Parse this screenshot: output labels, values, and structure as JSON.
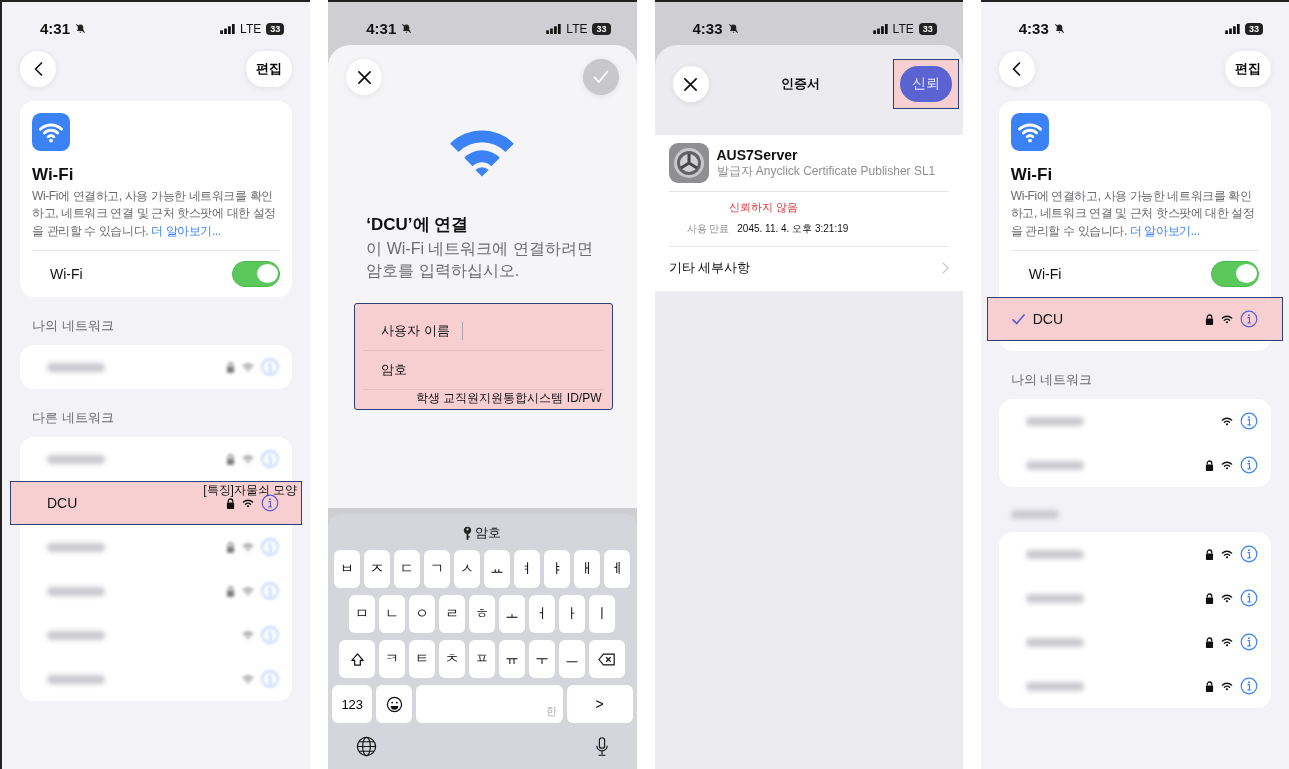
{
  "panels": [
    {
      "kind": "network_list",
      "status_bar": {
        "time": "4:31",
        "network": "LTE",
        "battery": "33"
      },
      "edit_button": "편집",
      "wifi_card": {
        "title": "Wi-Fi",
        "description": "Wi-Fi에 연결하고, 사용 가능한 네트워크를 확인하고, 네트워크 연결 및 근처 핫스팟에 대한 설정을 관리할 수 있습니다.",
        "link": "더 알아보기...",
        "toggle_label": "Wi-Fi",
        "on": true
      },
      "sections": [
        {
          "header": "나의 네트워크",
          "rows": [
            {
              "locked": true,
              "faded": true,
              "highlighted": false,
              "checked": false
            }
          ]
        },
        {
          "header": "다른 네트워크",
          "rows": [
            {
              "locked": true,
              "faded": true,
              "highlighted": false,
              "checked": false
            },
            {
              "name": "DCU",
              "note": "[특징]자물쇠 모양",
              "locked": true,
              "faded": false,
              "highlighted": true,
              "checked": false
            },
            {
              "locked": true,
              "faded": true,
              "highlighted": false,
              "checked": false
            },
            {
              "locked": true,
              "faded": true,
              "highlighted": false,
              "checked": false
            },
            {
              "locked": false,
              "faded": true,
              "highlighted": false,
              "checked": false
            },
            {
              "locked": false,
              "faded": true,
              "highlighted": false,
              "checked": false
            }
          ]
        }
      ]
    },
    {
      "kind": "join_form",
      "status_bar": {
        "time": "4:31",
        "network": "LTE",
        "battery": "33"
      },
      "confirm_disabled": true,
      "title": "‘DCU’에 연결",
      "subtitle": "이 Wi-Fi 네트워크에 연결하려면 암호를 입력하십시오.",
      "form": {
        "highlighted": true,
        "note": "학생 교직원지원통합시스템 ID/PW",
        "fields": [
          {
            "label": "사용자 이름",
            "focused": true
          },
          {
            "label": "암호",
            "focused": false
          }
        ]
      },
      "keyboard": {
        "suggestion": "암호",
        "rows": [
          [
            "ㅂ",
            "ㅈ",
            "ㄷ",
            "ㄱ",
            "ㅅ",
            "ㅛ",
            "ㅕ",
            "ㅑ",
            "ㅐ",
            "ㅔ"
          ],
          [
            "ㅁ",
            "ㄴ",
            "ㅇ",
            "ㄹ",
            "ㅎ",
            "ㅗ",
            "ㅓ",
            "ㅏ",
            "ㅣ"
          ],
          [
            "ㅋ",
            "ㅌ",
            "ㅊ",
            "ㅍ",
            "ㅠ",
            "ㅜ",
            "ㅡ"
          ]
        ],
        "numbers_key": "123",
        "space_hint": "한",
        "return_key": ">"
      }
    },
    {
      "kind": "certificate",
      "status_bar": {
        "time": "4:33",
        "network": "LTE",
        "battery": "33"
      },
      "title": "인증서",
      "trust_button": {
        "label": "신뢰",
        "highlighted": true
      },
      "certificate": {
        "name": "AUS7Server",
        "issuer": "발급자 Anyclick Certificate Publisher SL1",
        "status": "신뢰하지 않음",
        "expiry_label": "사용 만료",
        "expiry": "2045. 11. 4. 오후 3:21:19"
      },
      "details_row": "기타 세부사항"
    },
    {
      "kind": "network_list",
      "status_bar": {
        "time": "4:33",
        "battery": "33"
      },
      "edit_button": "편집",
      "wifi_card": {
        "title": "Wi-Fi",
        "description": "Wi-Fi에 연결하고, 사용 가능한 네트워크를 확인하고, 네트워크 연결 및 근처 핫스팟에 대한 설정을 관리할 수 있습니다.",
        "link": "더 알아보기...",
        "toggle_label": "Wi-Fi",
        "on": true,
        "connected": {
          "name": "DCU",
          "locked": true,
          "faded": false,
          "highlighted": true,
          "checked": true
        }
      },
      "sections": [
        {
          "header": "나의 네트워크",
          "rows": [
            {
              "locked": false,
              "faded": false,
              "highlighted": false,
              "checked": false
            },
            {
              "locked": true,
              "faded": false,
              "highlighted": false,
              "checked": false
            }
          ]
        },
        {
          "rows": [
            {
              "locked": true,
              "faded": false,
              "highlighted": false,
              "checked": false
            },
            {
              "locked": true,
              "faded": false,
              "highlighted": false,
              "checked": false
            },
            {
              "locked": true,
              "faded": false,
              "highlighted": false,
              "checked": false
            },
            {
              "locked": true,
              "faded": false,
              "highlighted": false,
              "checked": false
            }
          ]
        }
      ]
    }
  ]
}
